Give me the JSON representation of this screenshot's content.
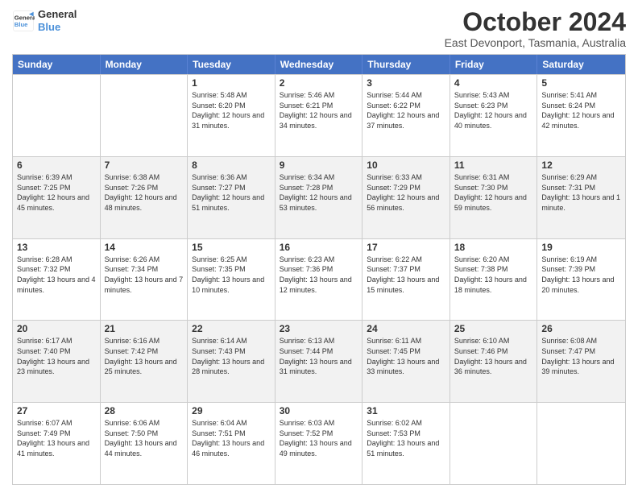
{
  "logo": {
    "line1": "General",
    "line2": "Blue"
  },
  "title": "October 2024",
  "subtitle": "East Devonport, Tasmania, Australia",
  "days_of_week": [
    "Sunday",
    "Monday",
    "Tuesday",
    "Wednesday",
    "Thursday",
    "Friday",
    "Saturday"
  ],
  "weeks": [
    [
      {
        "day": "",
        "info": ""
      },
      {
        "day": "",
        "info": ""
      },
      {
        "day": "1",
        "info": "Sunrise: 5:48 AM\nSunset: 6:20 PM\nDaylight: 12 hours and 31 minutes."
      },
      {
        "day": "2",
        "info": "Sunrise: 5:46 AM\nSunset: 6:21 PM\nDaylight: 12 hours and 34 minutes."
      },
      {
        "day": "3",
        "info": "Sunrise: 5:44 AM\nSunset: 6:22 PM\nDaylight: 12 hours and 37 minutes."
      },
      {
        "day": "4",
        "info": "Sunrise: 5:43 AM\nSunset: 6:23 PM\nDaylight: 12 hours and 40 minutes."
      },
      {
        "day": "5",
        "info": "Sunrise: 5:41 AM\nSunset: 6:24 PM\nDaylight: 12 hours and 42 minutes."
      }
    ],
    [
      {
        "day": "6",
        "info": "Sunrise: 6:39 AM\nSunset: 7:25 PM\nDaylight: 12 hours and 45 minutes."
      },
      {
        "day": "7",
        "info": "Sunrise: 6:38 AM\nSunset: 7:26 PM\nDaylight: 12 hours and 48 minutes."
      },
      {
        "day": "8",
        "info": "Sunrise: 6:36 AM\nSunset: 7:27 PM\nDaylight: 12 hours and 51 minutes."
      },
      {
        "day": "9",
        "info": "Sunrise: 6:34 AM\nSunset: 7:28 PM\nDaylight: 12 hours and 53 minutes."
      },
      {
        "day": "10",
        "info": "Sunrise: 6:33 AM\nSunset: 7:29 PM\nDaylight: 12 hours and 56 minutes."
      },
      {
        "day": "11",
        "info": "Sunrise: 6:31 AM\nSunset: 7:30 PM\nDaylight: 12 hours and 59 minutes."
      },
      {
        "day": "12",
        "info": "Sunrise: 6:29 AM\nSunset: 7:31 PM\nDaylight: 13 hours and 1 minute."
      }
    ],
    [
      {
        "day": "13",
        "info": "Sunrise: 6:28 AM\nSunset: 7:32 PM\nDaylight: 13 hours and 4 minutes."
      },
      {
        "day": "14",
        "info": "Sunrise: 6:26 AM\nSunset: 7:34 PM\nDaylight: 13 hours and 7 minutes."
      },
      {
        "day": "15",
        "info": "Sunrise: 6:25 AM\nSunset: 7:35 PM\nDaylight: 13 hours and 10 minutes."
      },
      {
        "day": "16",
        "info": "Sunrise: 6:23 AM\nSunset: 7:36 PM\nDaylight: 13 hours and 12 minutes."
      },
      {
        "day": "17",
        "info": "Sunrise: 6:22 AM\nSunset: 7:37 PM\nDaylight: 13 hours and 15 minutes."
      },
      {
        "day": "18",
        "info": "Sunrise: 6:20 AM\nSunset: 7:38 PM\nDaylight: 13 hours and 18 minutes."
      },
      {
        "day": "19",
        "info": "Sunrise: 6:19 AM\nSunset: 7:39 PM\nDaylight: 13 hours and 20 minutes."
      }
    ],
    [
      {
        "day": "20",
        "info": "Sunrise: 6:17 AM\nSunset: 7:40 PM\nDaylight: 13 hours and 23 minutes."
      },
      {
        "day": "21",
        "info": "Sunrise: 6:16 AM\nSunset: 7:42 PM\nDaylight: 13 hours and 25 minutes."
      },
      {
        "day": "22",
        "info": "Sunrise: 6:14 AM\nSunset: 7:43 PM\nDaylight: 13 hours and 28 minutes."
      },
      {
        "day": "23",
        "info": "Sunrise: 6:13 AM\nSunset: 7:44 PM\nDaylight: 13 hours and 31 minutes."
      },
      {
        "day": "24",
        "info": "Sunrise: 6:11 AM\nSunset: 7:45 PM\nDaylight: 13 hours and 33 minutes."
      },
      {
        "day": "25",
        "info": "Sunrise: 6:10 AM\nSunset: 7:46 PM\nDaylight: 13 hours and 36 minutes."
      },
      {
        "day": "26",
        "info": "Sunrise: 6:08 AM\nSunset: 7:47 PM\nDaylight: 13 hours and 39 minutes."
      }
    ],
    [
      {
        "day": "27",
        "info": "Sunrise: 6:07 AM\nSunset: 7:49 PM\nDaylight: 13 hours and 41 minutes."
      },
      {
        "day": "28",
        "info": "Sunrise: 6:06 AM\nSunset: 7:50 PM\nDaylight: 13 hours and 44 minutes."
      },
      {
        "day": "29",
        "info": "Sunrise: 6:04 AM\nSunset: 7:51 PM\nDaylight: 13 hours and 46 minutes."
      },
      {
        "day": "30",
        "info": "Sunrise: 6:03 AM\nSunset: 7:52 PM\nDaylight: 13 hours and 49 minutes."
      },
      {
        "day": "31",
        "info": "Sunrise: 6:02 AM\nSunset: 7:53 PM\nDaylight: 13 hours and 51 minutes."
      },
      {
        "day": "",
        "info": ""
      },
      {
        "day": "",
        "info": ""
      }
    ]
  ]
}
